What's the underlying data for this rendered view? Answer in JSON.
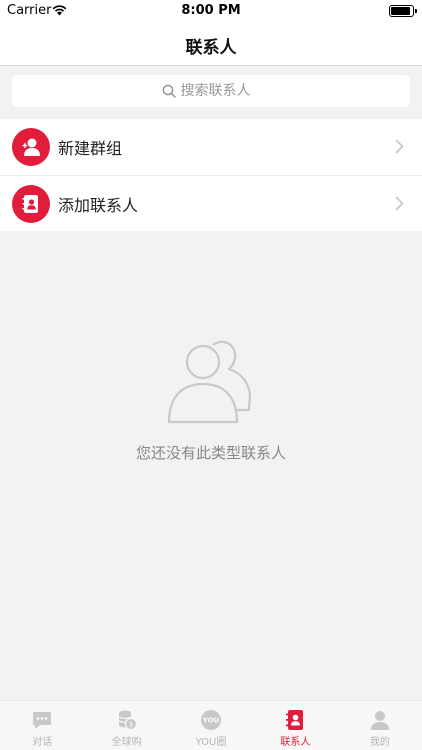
{
  "status_bar": {
    "carrier": "Carrier",
    "time": "8:00 PM"
  },
  "nav": {
    "title": "联系人"
  },
  "search": {
    "placeholder": "搜索联系人"
  },
  "menu": {
    "items": [
      {
        "label": "新建群组",
        "icon": "group-add-icon"
      },
      {
        "label": "添加联系人",
        "icon": "contact-book-icon"
      }
    ]
  },
  "empty_state": {
    "message": "您还没有此类型联系人"
  },
  "tabs": [
    {
      "label": "对话",
      "icon": "chat-icon",
      "active": false
    },
    {
      "label": "全球购",
      "icon": "coins-icon",
      "active": false
    },
    {
      "label": "YOU圈",
      "icon": "you-circle-icon",
      "active": false
    },
    {
      "label": "联系人",
      "icon": "contacts-icon",
      "active": true
    },
    {
      "label": "我的",
      "icon": "profile-icon",
      "active": false
    }
  ],
  "colors": {
    "accent": "#e11d3b",
    "inactive": "#b5b5b5",
    "background": "#f2f2f2"
  }
}
